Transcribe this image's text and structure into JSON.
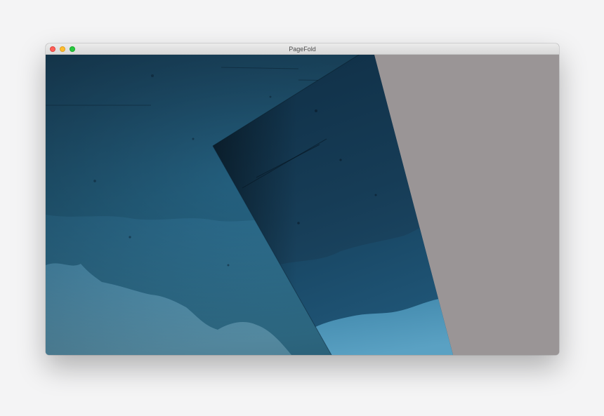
{
  "window": {
    "title": "PageFold"
  },
  "colors": {
    "desktop": "#f4f4f5",
    "canvas_background": "#9a9596",
    "close": "#fe5f57",
    "minimize": "#febc2e",
    "maximize": "#28c840"
  }
}
